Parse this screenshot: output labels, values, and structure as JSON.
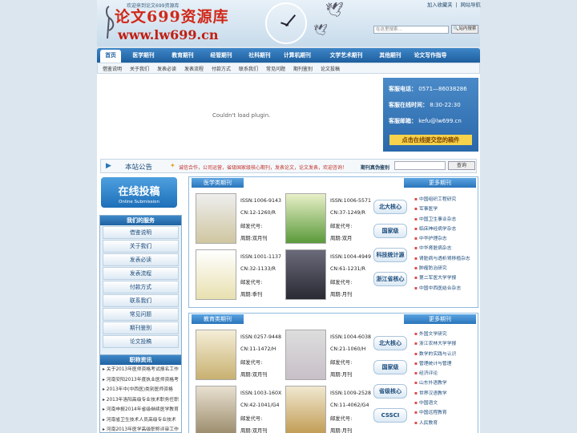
{
  "header": {
    "welcome": "欢迎来到论文699资源库",
    "logo_cn": "论文699资源库",
    "logo_url": "www.lw699.cn",
    "links": [
      "加入收藏夹",
      "网站导航"
    ],
    "search_placeholder": "在这里搜索...",
    "search_btn": "站内搜索"
  },
  "nav": [
    "首页",
    "医学期刊",
    "教育期刊",
    "经管期刊",
    "社科期刊",
    "计算机期刊",
    "文学艺术期刊",
    "其他期刊",
    "论文写作指导"
  ],
  "subnav": [
    "借鉴说明",
    "关于我们",
    "发表必读",
    "发表流程",
    "付款方式",
    "联系我们",
    "常见问题",
    "期刊鉴别",
    "论文投稿"
  ],
  "plugin": "Couldn't load plugin.",
  "kefu": {
    "phone_label": "客服电话：",
    "phone": "0571—86038286",
    "time_label": "客服在线时间：",
    "time": "8:30-22:30",
    "mail_label": "客服邮箱：",
    "mail": "kefu@lw699.cn",
    "submit": "点击在线提交您的稿件"
  },
  "notice": {
    "title": "本站公告",
    "text": "诚信合作，公司运营，省级国家级核心期刊，发表论文，论文发表，欢迎咨询！",
    "search_label": "期刊真伪鉴别",
    "search_btn": "查询"
  },
  "tougao": {
    "title": "在线投稿",
    "sub": "Online Submission"
  },
  "service": {
    "title": "我们的服务",
    "items": [
      "借鉴说明",
      "关于我们",
      "发表必读",
      "发表流程",
      "付款方式",
      "联系我们",
      "常见问题",
      "期刊鉴别",
      "论文投稿"
    ]
  },
  "news": {
    "title": "职称资讯",
    "items": [
      "关于2013年医师资格考试报名工作",
      "河南安阳2013年度执业医师资格考",
      "2013年中(中西医)类别医师资格",
      "2013年洛阳高级专业技术职务任职",
      "河南申报2014年省级继续医学教育",
      "河南省卫生技术人员高级专业技术",
      "河南2013年医学高级职称评审工作"
    ]
  },
  "medical": {
    "tab": "医学类期刊",
    "tab_right": "更多期刊",
    "mags": [
      {
        "issn": "ISSN:1006-9143",
        "cn": "CN:12-1260/R",
        "post": "邮发代号:",
        "cycle": "周期:双月刊"
      },
      {
        "issn": "ISSN:1006-5571",
        "cn": "CN:37-1249/R",
        "post": "邮发代号:",
        "cycle": "周期:双月"
      },
      {
        "issn": "ISSN:1001-1137",
        "cn": "CN:32-1133/R",
        "post": "邮发代号:",
        "cycle": "周期:季刊"
      },
      {
        "issn": "ISSN:1004-4949",
        "cn": "CN:61-1231/R",
        "post": "邮发代号:",
        "cycle": "周期:月刊"
      }
    ],
    "levels": [
      "北大核心",
      "国家级",
      "科技统计源",
      "浙江省核心"
    ],
    "list": [
      "中国组织工程研究",
      "军事医学",
      "中国卫生事业杂志",
      "临床神经病学杂志",
      "中华护理杂志",
      "中华肾脏病杂志",
      "肾脏病与透析肾移植杂志",
      "肿瘤防治研究",
      "第二军医大学学报",
      "中国中西医结合杂志"
    ]
  },
  "education": {
    "tab": "教育类期刊",
    "tab_right": "更多期刊",
    "mags": [
      {
        "issn": "ISSN:0257-9448",
        "cn": "CN:11-1472/H",
        "post": "邮发代号:",
        "cycle": "周期:双月刊"
      },
      {
        "issn": "ISSN:1004-6038",
        "cn": "CN:21-1060/H",
        "post": "邮发代号:",
        "cycle": "周期:月刊"
      },
      {
        "issn": "ISSN:1003-160X",
        "cn": "CN:42-1041/G4",
        "post": "邮发代号:",
        "cycle": "周期:双月刊"
      },
      {
        "issn": "ISSN:1009-2528",
        "cn": "CN:11-4062/G4",
        "post": "邮发代号:",
        "cycle": "周期:月刊"
      }
    ],
    "levels": [
      "北大核心",
      "国家级",
      "省级核心",
      "CSSCI"
    ],
    "list": [
      "外国文学研究",
      "浙江农林大学学报",
      "数学的实践与认识",
      "管理统计与管理",
      "经济评论",
      "山东外语教学",
      "世界汉语教学",
      "中国语文",
      "中国远程教育",
      "人民教育"
    ]
  }
}
